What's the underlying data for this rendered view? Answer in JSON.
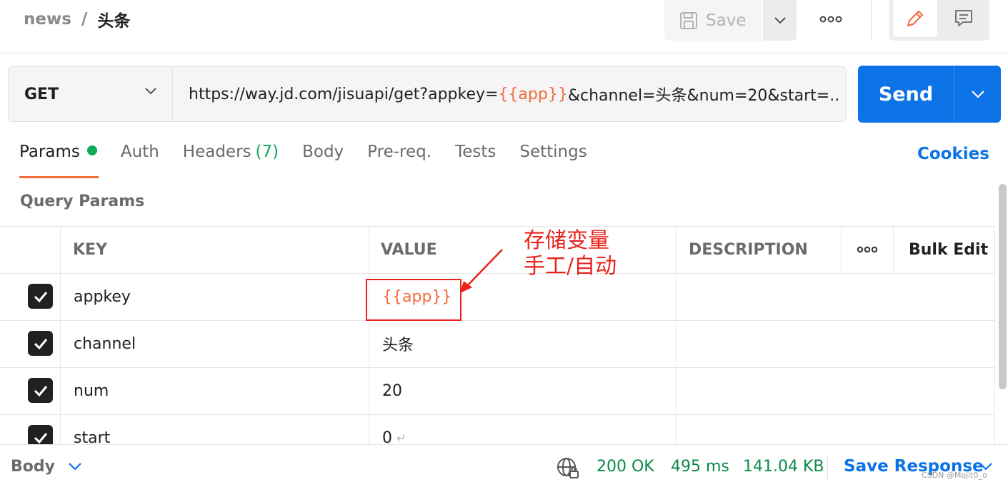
{
  "header": {
    "collection": "news",
    "separator": "/",
    "request_name": "头条",
    "save_label": "Save"
  },
  "request": {
    "method": "GET",
    "url_prefix": "https://way.jd.com/jisuapi/get?appkey=",
    "url_var": "{{app}}",
    "url_suffix": "&channel=头条&num=20&start=...",
    "send_label": "Send"
  },
  "tabs": [
    {
      "label": "Params",
      "active": true,
      "dot": true
    },
    {
      "label": "Auth"
    },
    {
      "label": "Headers",
      "count": "(7)"
    },
    {
      "label": "Body"
    },
    {
      "label": "Pre-req."
    },
    {
      "label": "Tests"
    },
    {
      "label": "Settings"
    }
  ],
  "cookies_label": "Cookies",
  "params": {
    "section_title": "Query Params",
    "columns": {
      "key": "KEY",
      "value": "VALUE",
      "description": "DESCRIPTION",
      "bulk_edit": "Bulk Edit"
    },
    "rows": [
      {
        "key": "appkey",
        "value": "{{app}}",
        "is_var": true
      },
      {
        "key": "channel",
        "value": "头条"
      },
      {
        "key": "num",
        "value": "20"
      },
      {
        "key": "start",
        "value": "0",
        "newline_mark": "↵"
      }
    ]
  },
  "annotation": {
    "line1": "存储变量",
    "line2": "手工/自动"
  },
  "footer": {
    "body_label": "Body",
    "status": "200 OK",
    "time": "495 ms",
    "size": "141.04 KB",
    "save_response": "Save Response",
    "watermark": "CSDN @Mojit0_o"
  },
  "colors": {
    "accent": "#f26b3a",
    "primary": "#0b73e6",
    "success": "#0fa958",
    "annotation": "#e8231b"
  }
}
